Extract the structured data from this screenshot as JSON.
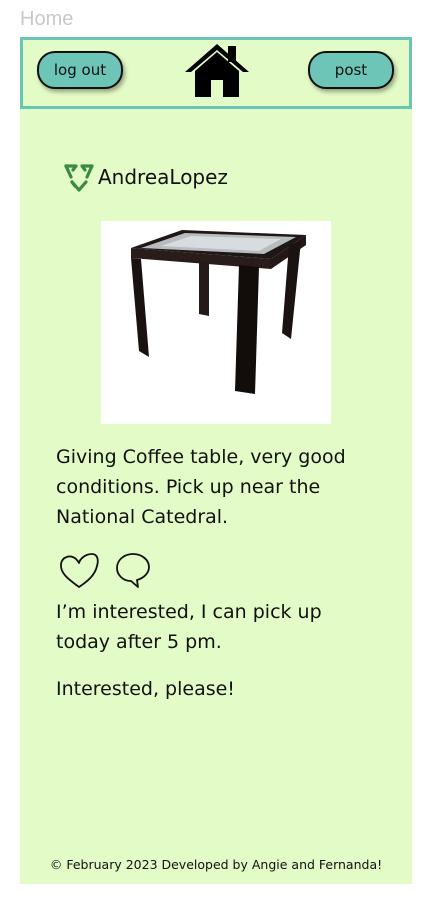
{
  "page_label": "Home",
  "header": {
    "logout_label": "log out",
    "post_label": "post",
    "home_icon": "home-icon"
  },
  "post": {
    "username": "AndreaLopez",
    "user_icon": "recycle-icon",
    "photo": "coffee-table-photo",
    "description": "Giving Coffee table, very good conditions. Pick up near the National Catedral.",
    "actions": [
      "heart-icon",
      "comment-icon"
    ],
    "comments": [
      "I’m interested, I can pick up today after 5 pm.",
      "Interested, please!"
    ]
  },
  "footer": {
    "text": "© February 2023 Developed by Angie and Fernanda!"
  },
  "colors": {
    "page_bg": "#e3fbc6",
    "accent": "#6cc5b6",
    "border": "#6ac5b6",
    "recycle_green": "#3a8a44"
  }
}
